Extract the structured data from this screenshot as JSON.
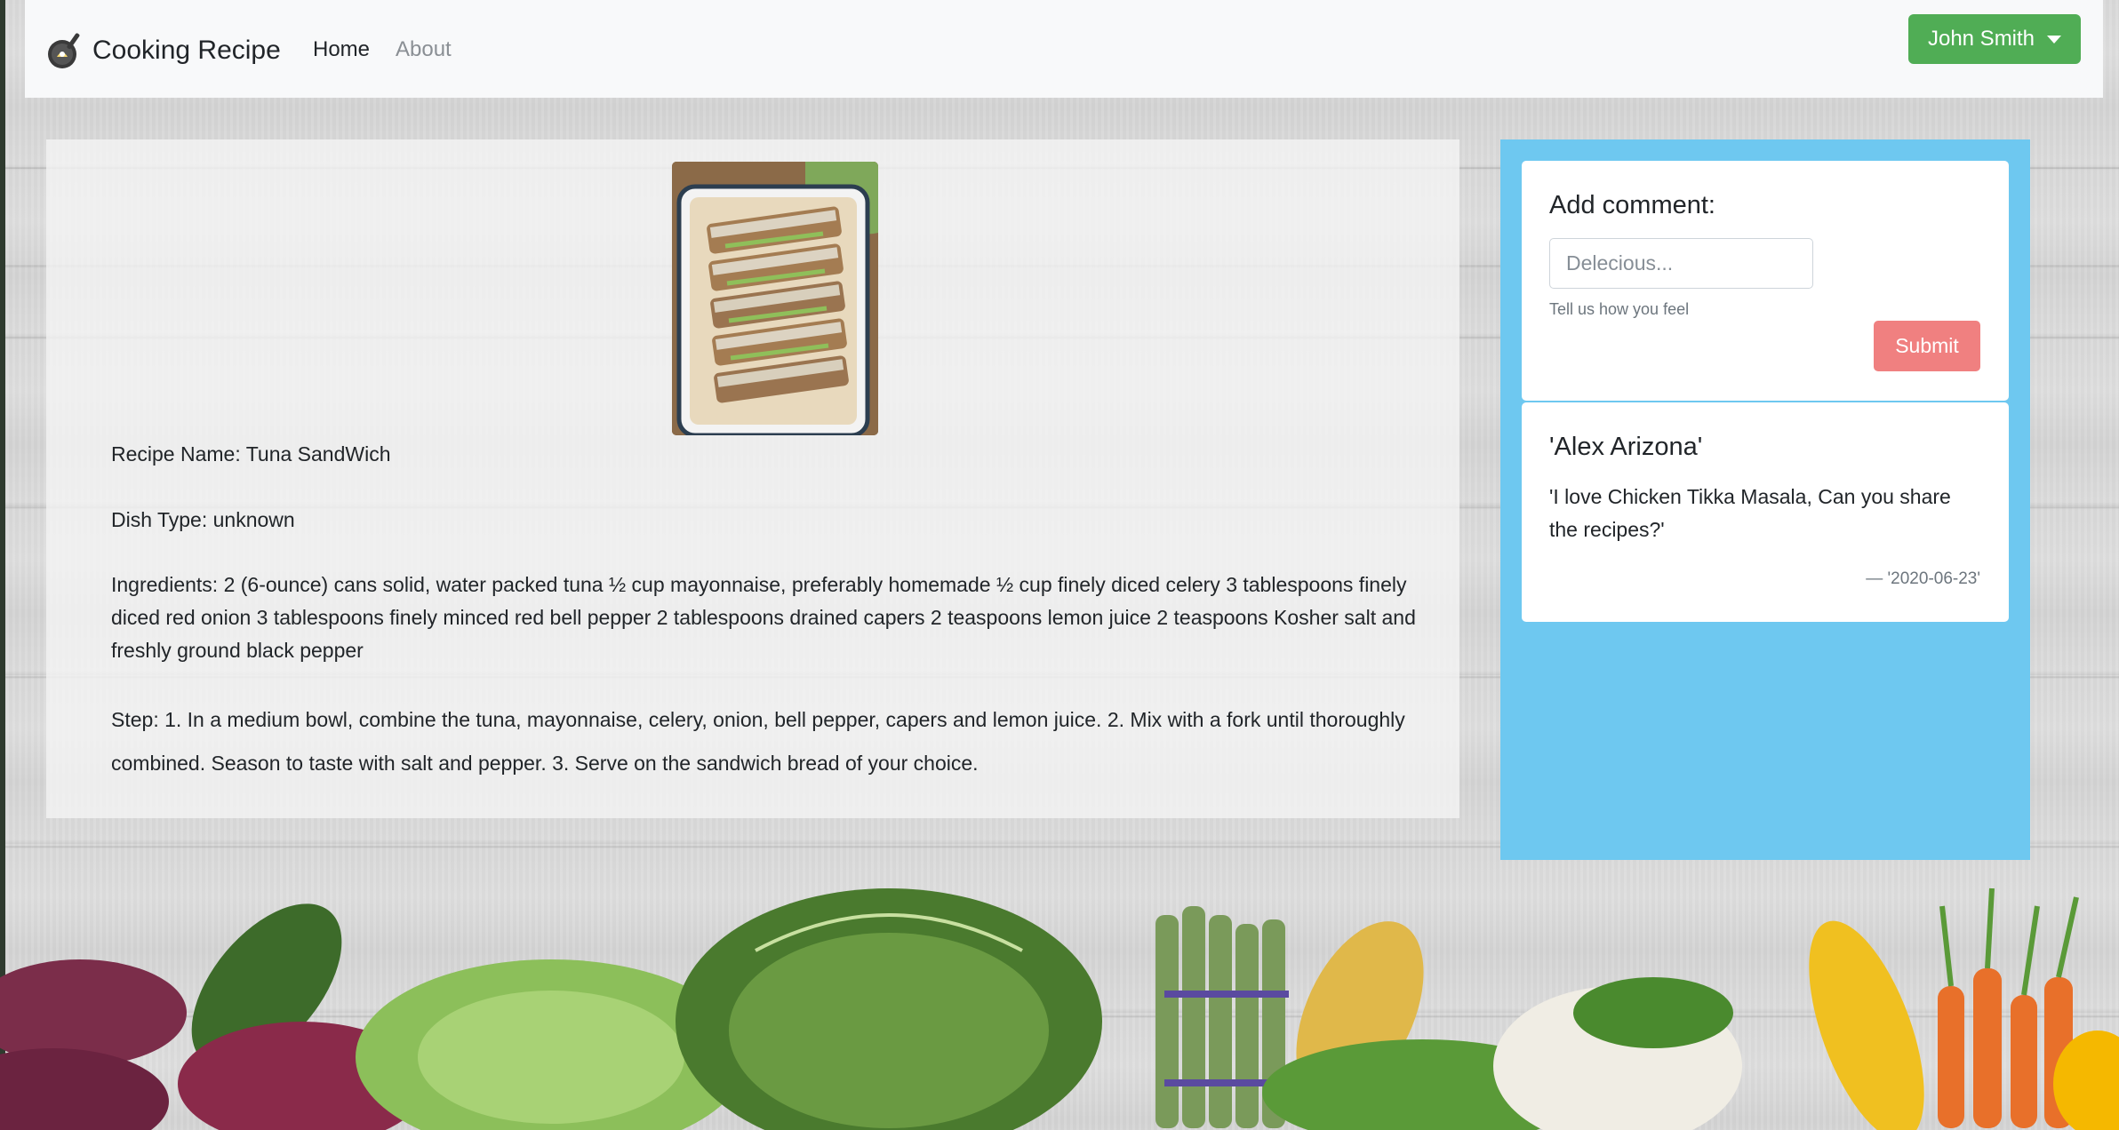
{
  "navbar": {
    "brand": "Cooking Recipe",
    "links": [
      "Home",
      "About"
    ],
    "user": "John Smith"
  },
  "recipe": {
    "name_line": "Recipe Name: Tuna SandWich",
    "type_line": "Dish Type: unknown",
    "ingredients_line": "Ingredients: 2 (6-ounce) cans solid, water packed tuna ½ cup mayonnaise, preferably homemade ½ cup finely diced celery 3 tablespoons finely diced red onion 3 tablespoons finely minced red bell pepper 2 tablespoons drained capers 2 teaspoons lemon juice 2 teaspoons Kosher salt and freshly ground black pepper",
    "step_line": "Step: 1. In a medium bowl, combine the tuna, mayonnaise, celery, onion, bell pepper, capers and lemon juice. 2. Mix with a fork until thoroughly combined. Season to taste with salt and pepper. 3. Serve on the sandwich bread of your choice."
  },
  "comment_form": {
    "title": "Add comment:",
    "placeholder": "Delecious...",
    "help": "Tell us how you feel",
    "submit": "Submit"
  },
  "comments": [
    {
      "author": "'Alex Arizona'",
      "text": "'I love Chicken Tikka Masala, Can you share the recipes?'",
      "date": "— '2020-06-23'"
    }
  ],
  "colors": {
    "user_button": "#50ad55",
    "side_panel": "#6ec8f0",
    "submit_button": "#f08080"
  }
}
